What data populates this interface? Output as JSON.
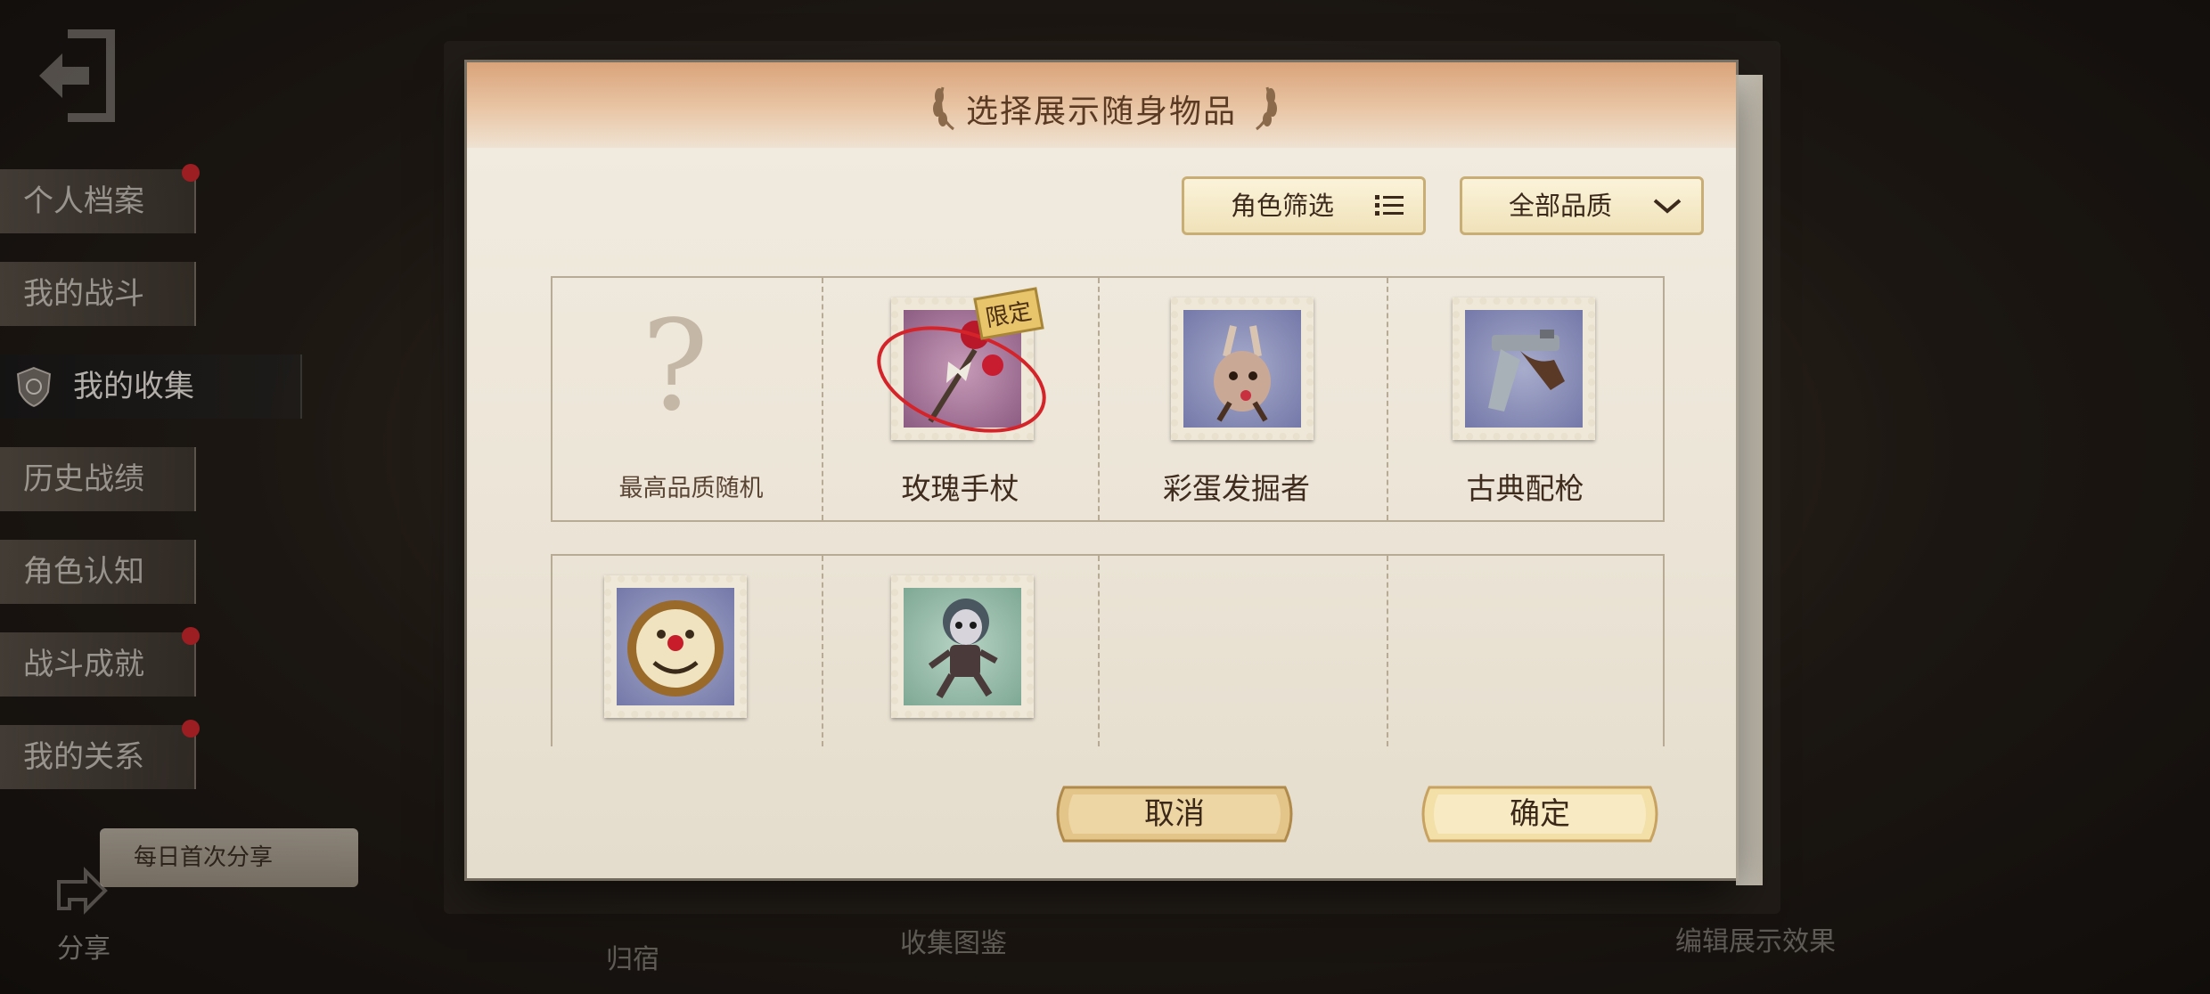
{
  "sidebar": {
    "items": [
      {
        "label": "个人档案",
        "dot": true
      },
      {
        "label": "我的战斗",
        "dot": false
      },
      {
        "label": "我的收集",
        "dot": false,
        "active": true
      },
      {
        "label": "历史战绩",
        "dot": false
      },
      {
        "label": "角色认知",
        "dot": false
      },
      {
        "label": "战斗成就",
        "dot": true
      },
      {
        "label": "我的关系",
        "dot": true
      }
    ],
    "share_tip": "每日首次分享",
    "share_label": "分享"
  },
  "background": {
    "bottom_left_label": "归宿",
    "bottom_center_label": "收集图鉴",
    "bottom_right_label": "编辑展示效果"
  },
  "modal": {
    "title": "选择展示随身物品",
    "filters": {
      "character_filter": "角色筛选",
      "quality_filter": "全部品质"
    },
    "items": [
      {
        "label": "最高品质随机",
        "icon": "question-mark-icon"
      },
      {
        "label": "玫瑰手杖",
        "icon": "rose-cane-icon",
        "badge": "限定",
        "selected": true
      },
      {
        "label": "彩蛋发掘者",
        "icon": "egg-bunny-icon"
      },
      {
        "label": "古典配枪",
        "icon": "flintlock-pistol-icon"
      },
      {
        "label": "",
        "icon": "clown-drum-icon"
      },
      {
        "label": "",
        "icon": "doll-icon"
      }
    ],
    "cancel_label": "取消",
    "confirm_label": "确定"
  },
  "colors": {
    "title_text": "#5a3a22",
    "selection_ring": "#d4242a",
    "badge_gold": "#e8c46a"
  }
}
